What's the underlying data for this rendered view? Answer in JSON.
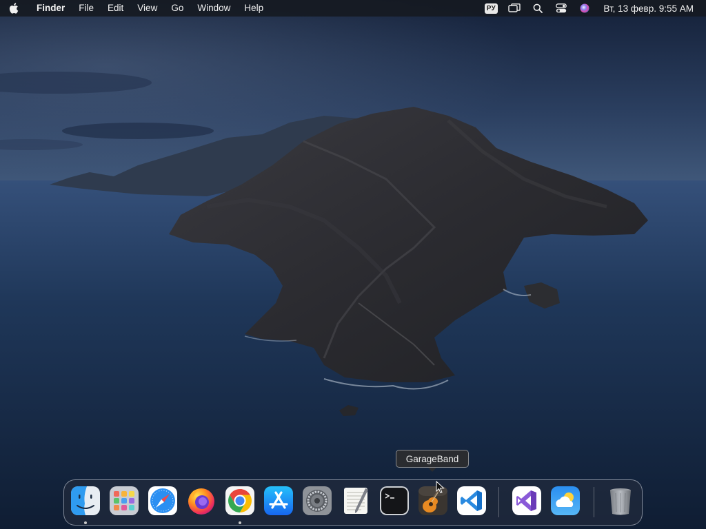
{
  "menubar": {
    "app_name": "Finder",
    "items": [
      "File",
      "Edit",
      "View",
      "Go",
      "Window",
      "Help"
    ],
    "input_source": "РУ",
    "clock": "Вт, 13 февр.  9:55 AM",
    "status_icons": [
      "input-source-icon",
      "screen-mirroring-icon",
      "spotlight-search-icon",
      "control-center-icon",
      "siri-icon"
    ]
  },
  "tooltip": {
    "label": "GarageBand"
  },
  "dock": {
    "apps": [
      {
        "name": "Finder",
        "icon": "finder-icon",
        "running": true
      },
      {
        "name": "Launchpad",
        "icon": "launchpad-icon",
        "running": false
      },
      {
        "name": "Safari",
        "icon": "safari-icon",
        "running": false
      },
      {
        "name": "Firefox",
        "icon": "firefox-icon",
        "running": false
      },
      {
        "name": "Google Chrome",
        "icon": "chrome-icon",
        "running": true
      },
      {
        "name": "App Store",
        "icon": "app-store-icon",
        "running": false
      },
      {
        "name": "System Preferences",
        "icon": "system-preferences-icon",
        "running": false
      },
      {
        "name": "TextEdit",
        "icon": "textedit-icon",
        "running": false
      },
      {
        "name": "Terminal",
        "icon": "terminal-icon",
        "running": false
      },
      {
        "name": "GarageBand",
        "icon": "garageband-icon",
        "running": false
      },
      {
        "name": "Visual Studio Code",
        "icon": "vscode-icon",
        "running": false
      },
      {
        "name": "Visual Studio",
        "icon": "visual-studio-icon",
        "running": false
      },
      {
        "name": "Weather",
        "icon": "weather-icon",
        "running": false
      },
      {
        "name": "Trash",
        "icon": "trash-icon",
        "running": false
      }
    ]
  },
  "colors": {
    "sky_top": "#16233c",
    "sky_horizon": "#3e5576",
    "sea": "#1a2e4c",
    "island": "#2a2b30"
  }
}
